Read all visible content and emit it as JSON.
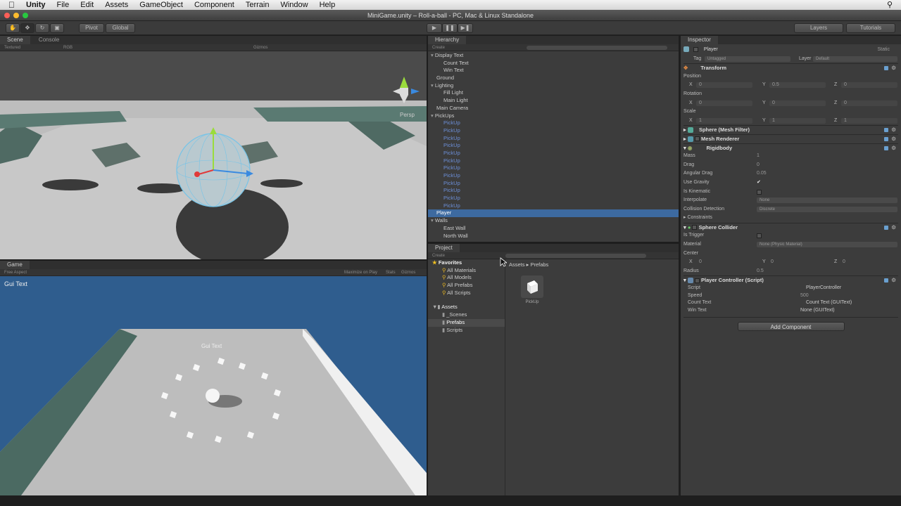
{
  "menubar": {
    "app": "Unity",
    "items": [
      "File",
      "Edit",
      "Assets",
      "GameObject",
      "Component",
      "Terrain",
      "Window",
      "Help"
    ]
  },
  "window_title": "MiniGame.unity – Roll-a-ball - PC, Mac & Linux Standalone",
  "toolbar": {
    "pivot": "Pivot",
    "global": "Global",
    "layers": "Layers",
    "tutorials": "Tutorials"
  },
  "scene": {
    "tab": "Scene",
    "console_tab": "Console",
    "textured": "Textured",
    "rgb": "RGB",
    "gizmos": "Gizmos",
    "persp": "Persp"
  },
  "game": {
    "tab": "Game",
    "aspect": "Free Aspect",
    "maximize": "Maximize on Play",
    "stats": "Stats",
    "gizmos": "Gizmos",
    "gui_text": "Gui Text",
    "gui_text_center": "Gui Text"
  },
  "hierarchy": {
    "tab": "Hierarchy",
    "create": "Create",
    "rows": [
      {
        "label": "Display Text",
        "indent": 1,
        "fold": true
      },
      {
        "label": "Count Text",
        "indent": 2
      },
      {
        "label": "Win Text",
        "indent": 2
      },
      {
        "label": "Ground",
        "indent": 1
      },
      {
        "label": "Lighting",
        "indent": 1,
        "fold": true
      },
      {
        "label": "Fill Light",
        "indent": 2
      },
      {
        "label": "Main Light",
        "indent": 2
      },
      {
        "label": "Main Camera",
        "indent": 1
      },
      {
        "label": "PickUps",
        "indent": 1,
        "fold": true
      },
      {
        "label": "PickUp",
        "indent": 2,
        "prefab": true
      },
      {
        "label": "PickUp",
        "indent": 2,
        "prefab": true
      },
      {
        "label": "PickUp",
        "indent": 2,
        "prefab": true
      },
      {
        "label": "PickUp",
        "indent": 2,
        "prefab": true
      },
      {
        "label": "PickUp",
        "indent": 2,
        "prefab": true
      },
      {
        "label": "PickUp",
        "indent": 2,
        "prefab": true
      },
      {
        "label": "PickUp",
        "indent": 2,
        "prefab": true
      },
      {
        "label": "PickUp",
        "indent": 2,
        "prefab": true
      },
      {
        "label": "PickUp",
        "indent": 2,
        "prefab": true
      },
      {
        "label": "PickUp",
        "indent": 2,
        "prefab": true
      },
      {
        "label": "PickUp",
        "indent": 2,
        "prefab": true
      },
      {
        "label": "PickUp",
        "indent": 2,
        "prefab": true
      },
      {
        "label": "Player",
        "indent": 1,
        "selected": true
      },
      {
        "label": "Walls",
        "indent": 1,
        "fold": true
      },
      {
        "label": "East Wall",
        "indent": 2
      },
      {
        "label": "North Wall",
        "indent": 2
      }
    ]
  },
  "project": {
    "tab": "Project",
    "create": "Create",
    "favorites": "Favorites",
    "fav_items": [
      "All Materials",
      "All Models",
      "All Prefabs",
      "All Scripts"
    ],
    "assets": "Assets",
    "asset_folders": [
      "_Scenes",
      "Prefabs",
      "Scripts"
    ],
    "breadcrumb": [
      "Assets",
      "Prefabs"
    ],
    "asset_item": "PickUp"
  },
  "inspector": {
    "tab": "Inspector",
    "object_name": "Player",
    "static": "Static",
    "tag_label": "Tag",
    "tag_value": "Untagged",
    "layer_label": "Layer",
    "layer_value": "Default",
    "transform": {
      "title": "Transform",
      "position": "Position",
      "rotation": "Rotation",
      "scale": "Scale",
      "pos": [
        "0",
        "0.5",
        "0"
      ],
      "rot": [
        "0",
        "0",
        "0"
      ],
      "scl": [
        "1",
        "1",
        "1"
      ]
    },
    "mesh_filter": "Sphere (Mesh Filter)",
    "mesh_renderer": "Mesh Renderer",
    "rigidbody": {
      "title": "Rigidbody",
      "mass_l": "Mass",
      "mass": "1",
      "drag_l": "Drag",
      "drag": "0",
      "adrag_l": "Angular Drag",
      "adrag": "0.05",
      "grav_l": "Use Gravity",
      "kin_l": "Is Kinematic",
      "interp_l": "Interpolate",
      "interp": "None",
      "coll_l": "Collision Detection",
      "coll": "Discrete",
      "constraints": "Constraints"
    },
    "sphere_collider": {
      "title": "Sphere Collider",
      "trigger_l": "Is Trigger",
      "material_l": "Material",
      "material": "None (Physic Material)",
      "center_l": "Center",
      "center": [
        "0",
        "0",
        "0"
      ],
      "radius_l": "Radius",
      "radius": "0.5"
    },
    "player_controller": {
      "title": "Player Controller (Script)",
      "script_l": "Script",
      "script": "PlayerController",
      "speed_l": "Speed",
      "speed": "500",
      "count_l": "Count Text",
      "count": "Count Text (GUIText)",
      "win_l": "Win Text",
      "win": "None (GUIText)"
    },
    "add_component": "Add Component"
  }
}
